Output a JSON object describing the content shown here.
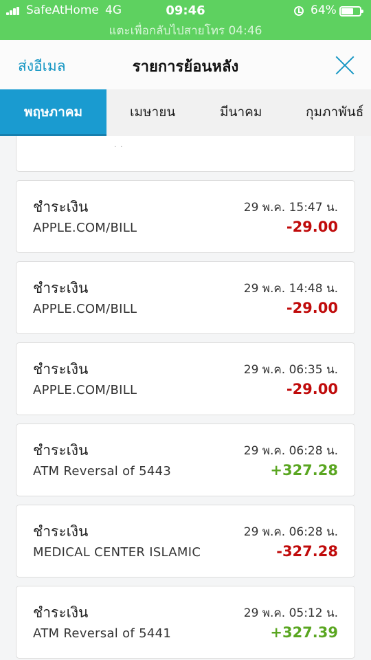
{
  "status_bar": {
    "carrier": "SafeAtHome",
    "network": "4G",
    "time": "09:46",
    "battery_percent": "64%",
    "call_banner": "แตะเพื่อกลับไปสายโทร 04:46"
  },
  "header": {
    "email_label": "ส่งอีเมล",
    "title": "รายการย้อนหลัง",
    "close_icon": "close-icon"
  },
  "tabs": [
    {
      "label": "พฤษภาคม",
      "active": true
    },
    {
      "label": "เมษายน",
      "active": false
    },
    {
      "label": "มีนาคม",
      "active": false
    },
    {
      "label": "กุมภาพันธ์",
      "active": false
    }
  ],
  "transactions": [
    {
      "type": "ชำระเงิน",
      "date": "29 พ.ค. 15:47 น.",
      "merchant": "APPLE.COM/BILL",
      "amount": "-29.00",
      "sign": "negative"
    },
    {
      "type": "ชำระเงิน",
      "date": "29 พ.ค. 14:48 น.",
      "merchant": "APPLE.COM/BILL",
      "amount": "-29.00",
      "sign": "negative"
    },
    {
      "type": "ชำระเงิน",
      "date": "29 พ.ค. 06:35 น.",
      "merchant": "APPLE.COM/BILL",
      "amount": "-29.00",
      "sign": "negative"
    },
    {
      "type": "ชำระเงิน",
      "date": "29 พ.ค. 06:28 น.",
      "merchant": "ATM Reversal of 5443",
      "amount": "+327.28",
      "sign": "positive"
    },
    {
      "type": "ชำระเงิน",
      "date": "29 พ.ค. 06:28 น.",
      "merchant": "MEDICAL CENTER ISLAMIC",
      "amount": "-327.28",
      "sign": "negative"
    },
    {
      "type": "ชำระเงิน",
      "date": "29 พ.ค. 05:12 น.",
      "merchant": "ATM Reversal of 5441",
      "amount": "+327.39",
      "sign": "positive"
    }
  ],
  "colors": {
    "status_bar": "#5ed160",
    "accent": "#1a9bd0",
    "negative": "#c00b0b",
    "positive": "#5aa621"
  }
}
